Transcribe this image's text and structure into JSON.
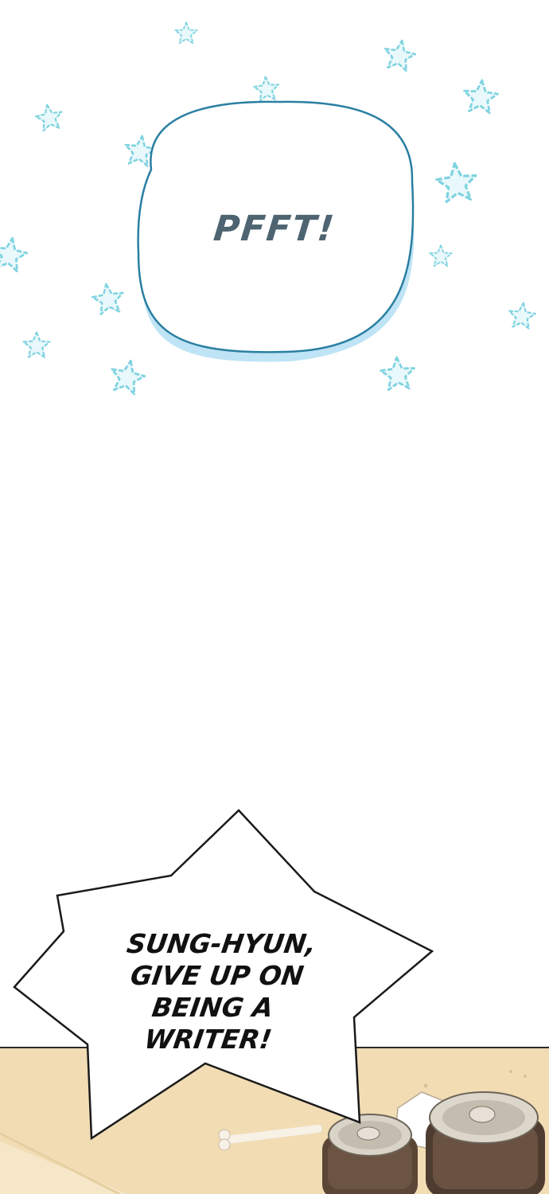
{
  "panel_top": {
    "sfx_text": "PFFT!",
    "decoration": "star-icon"
  },
  "panel_bottom": {
    "dialogue_lines": [
      "SUNG-HYUN,",
      "GIVE UP ON",
      "BEING A",
      "WRITER!"
    ]
  },
  "colors": {
    "star_fill": "#e8f8fb",
    "star_stroke": "#7fd3e0",
    "bubble_outline": "#2a7fa2",
    "bubble_shadow": "#bfe4f5",
    "sfx_text": "#4e6470",
    "table": "#f1dcb4",
    "can": "#5a4536"
  }
}
